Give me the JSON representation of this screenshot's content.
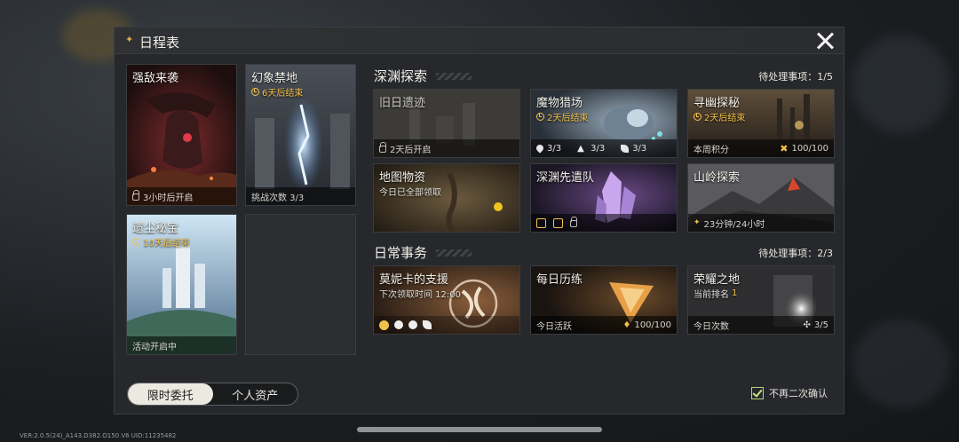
{
  "window": {
    "title": "日程表",
    "close_icon": "close-icon"
  },
  "left_cards": [
    {
      "title": "强敌来袭",
      "footer": "3小时后开启"
    },
    {
      "title": "幻象禁地",
      "timer": "6天后结束",
      "footer": "挑战次数 3/3"
    },
    {
      "title": "遗尘秘宝",
      "timer": "10天后结束",
      "footer": "活动开启中"
    }
  ],
  "abyss": {
    "section_title": "深渊探索",
    "pending": "待处理事项：1/5",
    "cards": [
      {
        "title": "旧日遗迹",
        "footer": "2天后开启"
      },
      {
        "title": "魔物猎场",
        "timer": "2天后结束",
        "stats": [
          "3/3",
          "3/3",
          "3/3"
        ]
      },
      {
        "title": "寻幽探秘",
        "timer": "2天后结束",
        "footer_left": "本周积分",
        "footer_right": "100/100"
      },
      {
        "title": "地图物资",
        "subtitle": "今日已全部领取"
      },
      {
        "title": "深渊先遣队"
      },
      {
        "title": "山岭探索",
        "footer": "23分钟/24小时"
      }
    ]
  },
  "daily": {
    "section_title": "日常事务",
    "pending": "待处理事项：2/3",
    "cards": [
      {
        "title": "莫妮卡的支援",
        "subtitle": "下次领取时间 12:00"
      },
      {
        "title": "每日历练",
        "footer_left": "今日活跃",
        "footer_right": "100/100"
      },
      {
        "title": "荣耀之地",
        "subtitle_label": "当前排名",
        "subtitle_value": "1",
        "footer_left": "今日次数",
        "footer_right": "3/5"
      }
    ]
  },
  "tabs": [
    {
      "label": "限时委托",
      "active": true
    },
    {
      "label": "个人资产",
      "active": false
    }
  ],
  "confirm": {
    "label": "不再二次确认",
    "checked": true
  },
  "version": "VER:2.0.5(24)_A143.D382.O150.V6   UID:11235482",
  "colors": {
    "timer": "#f2c24a",
    "accent_check": "#c8e57f",
    "panel": "#26282b"
  }
}
